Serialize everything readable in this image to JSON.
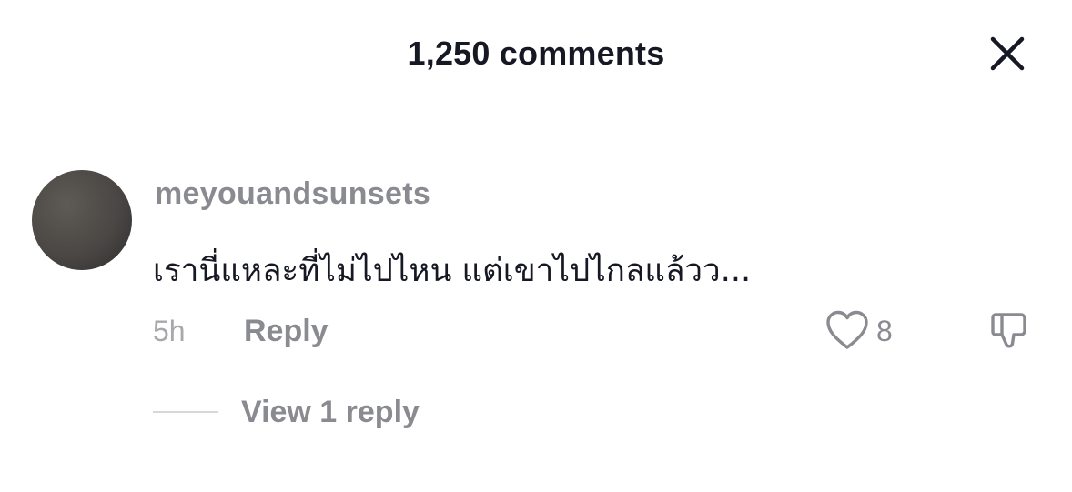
{
  "header": {
    "title": "1,250 comments",
    "close_icon": "close-icon"
  },
  "comment": {
    "avatar_color": "#4a4744",
    "username": "meyouandsunsets",
    "text": "เรานี่แหละที่ไม่ไปไหน แต่เขาไปไกลแล้วว...",
    "time": "5h",
    "reply_label": "Reply",
    "like_icon": "heart-outline-icon",
    "like_count": "8",
    "dislike_icon": "thumbs-down-icon",
    "view_replies_label": "View 1 reply"
  },
  "colors": {
    "primary_text": "#161823",
    "secondary_text": "#8a8b91",
    "muted_text": "#a7a8ac"
  }
}
